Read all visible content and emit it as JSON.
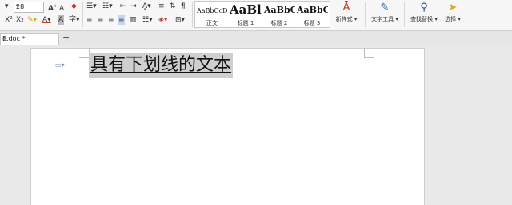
{
  "ribbon": {
    "font_size": "28",
    "styles": [
      {
        "preview": "AaBbCcDd",
        "name": "正文"
      },
      {
        "preview": "AaBl",
        "name": "标题 1"
      },
      {
        "preview": "AaBbC",
        "name": "标题 2"
      },
      {
        "preview": "AaBbC",
        "name": "标题 3"
      }
    ],
    "new_style_label": "新样式 ▾",
    "text_tools_label": "文字工具 ▾",
    "find_replace_label": "查找替换 ▾",
    "select_label": "选择 ▾"
  },
  "tabs": {
    "doc_name": "E.doc *",
    "close_glyph": "×",
    "new_tab_glyph": "+"
  },
  "document": {
    "text": "具有下划线的文本"
  },
  "colors": {
    "highlight": "#cfcfcf",
    "font_color_accent": "#c0392b",
    "highlighter_yellow": "#f5d000"
  }
}
